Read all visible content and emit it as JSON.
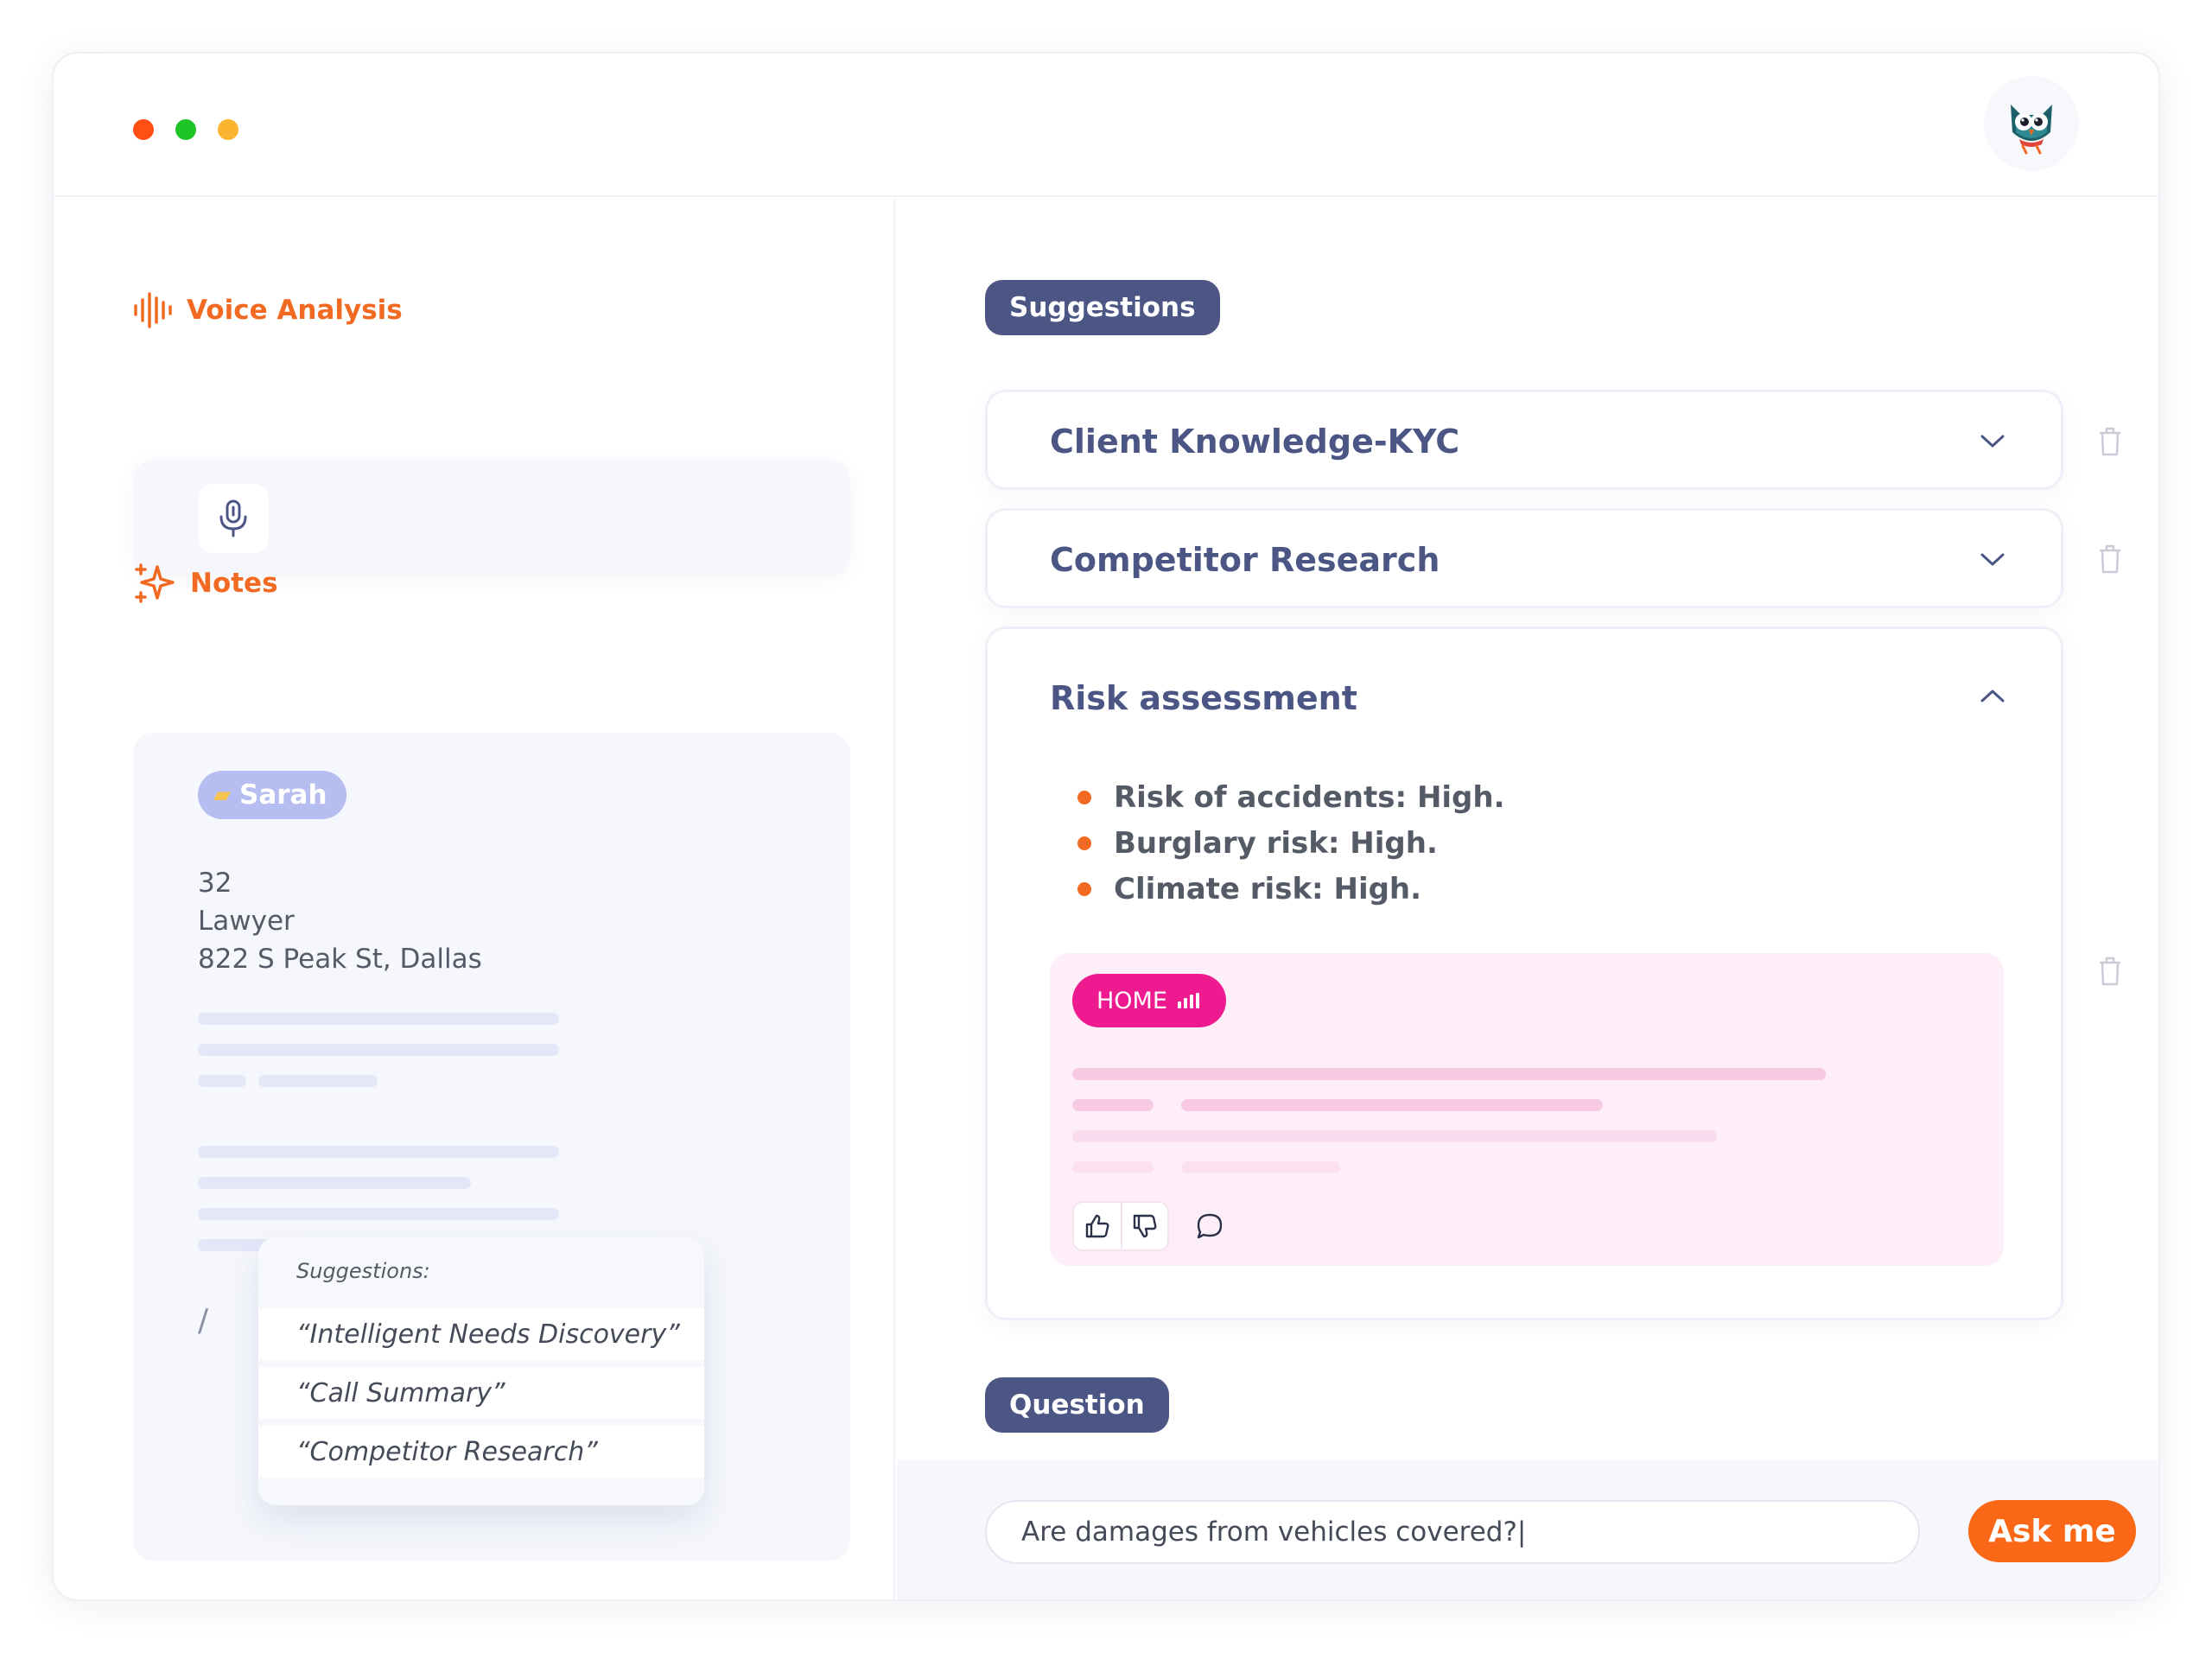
{
  "window": {
    "controls": [
      "close",
      "minimize",
      "maximize"
    ],
    "avatar_icon": "owl-avatar-icon"
  },
  "voice": {
    "title": "Voice Analysis",
    "icon": "waveform-icon",
    "mic_icon": "microphone-icon"
  },
  "notes": {
    "title": "Notes",
    "icon": "sparkle-icon",
    "tag": {
      "icon": "folder-icon",
      "label": "Sarah"
    },
    "lines": [
      "32",
      "Lawyer",
      "822 S Peak St, Dallas"
    ],
    "slash": "/",
    "popup": {
      "title": "Suggestions:",
      "items": [
        "“Intelligent Needs Discovery”",
        "“Call Summary”",
        "“Competitor Research”"
      ]
    }
  },
  "suggestions": {
    "label": "Suggestions",
    "cards": [
      {
        "title": "Client Knowledge-KYC",
        "state": "collapsed"
      },
      {
        "title": "Competitor Research",
        "state": "collapsed"
      },
      {
        "title": "Risk assessment",
        "state": "expanded",
        "bullets": [
          "Risk of accidents: High.",
          "Burglary risk: High.",
          "Climate risk: High."
        ],
        "badge": {
          "label": "HOME",
          "icon": "signal-bars-icon"
        },
        "actions": [
          "thumbs-up-icon",
          "thumbs-down-icon",
          "comment-icon"
        ]
      }
    ]
  },
  "question": {
    "label": "Question",
    "input_value": "Are damages from vehicles covered?|",
    "ask_label": "Ask me"
  },
  "colors": {
    "accent": "#f26a21",
    "pill": "#4b5685",
    "pink": "#ee1a8f",
    "ask": "#fa6716"
  }
}
